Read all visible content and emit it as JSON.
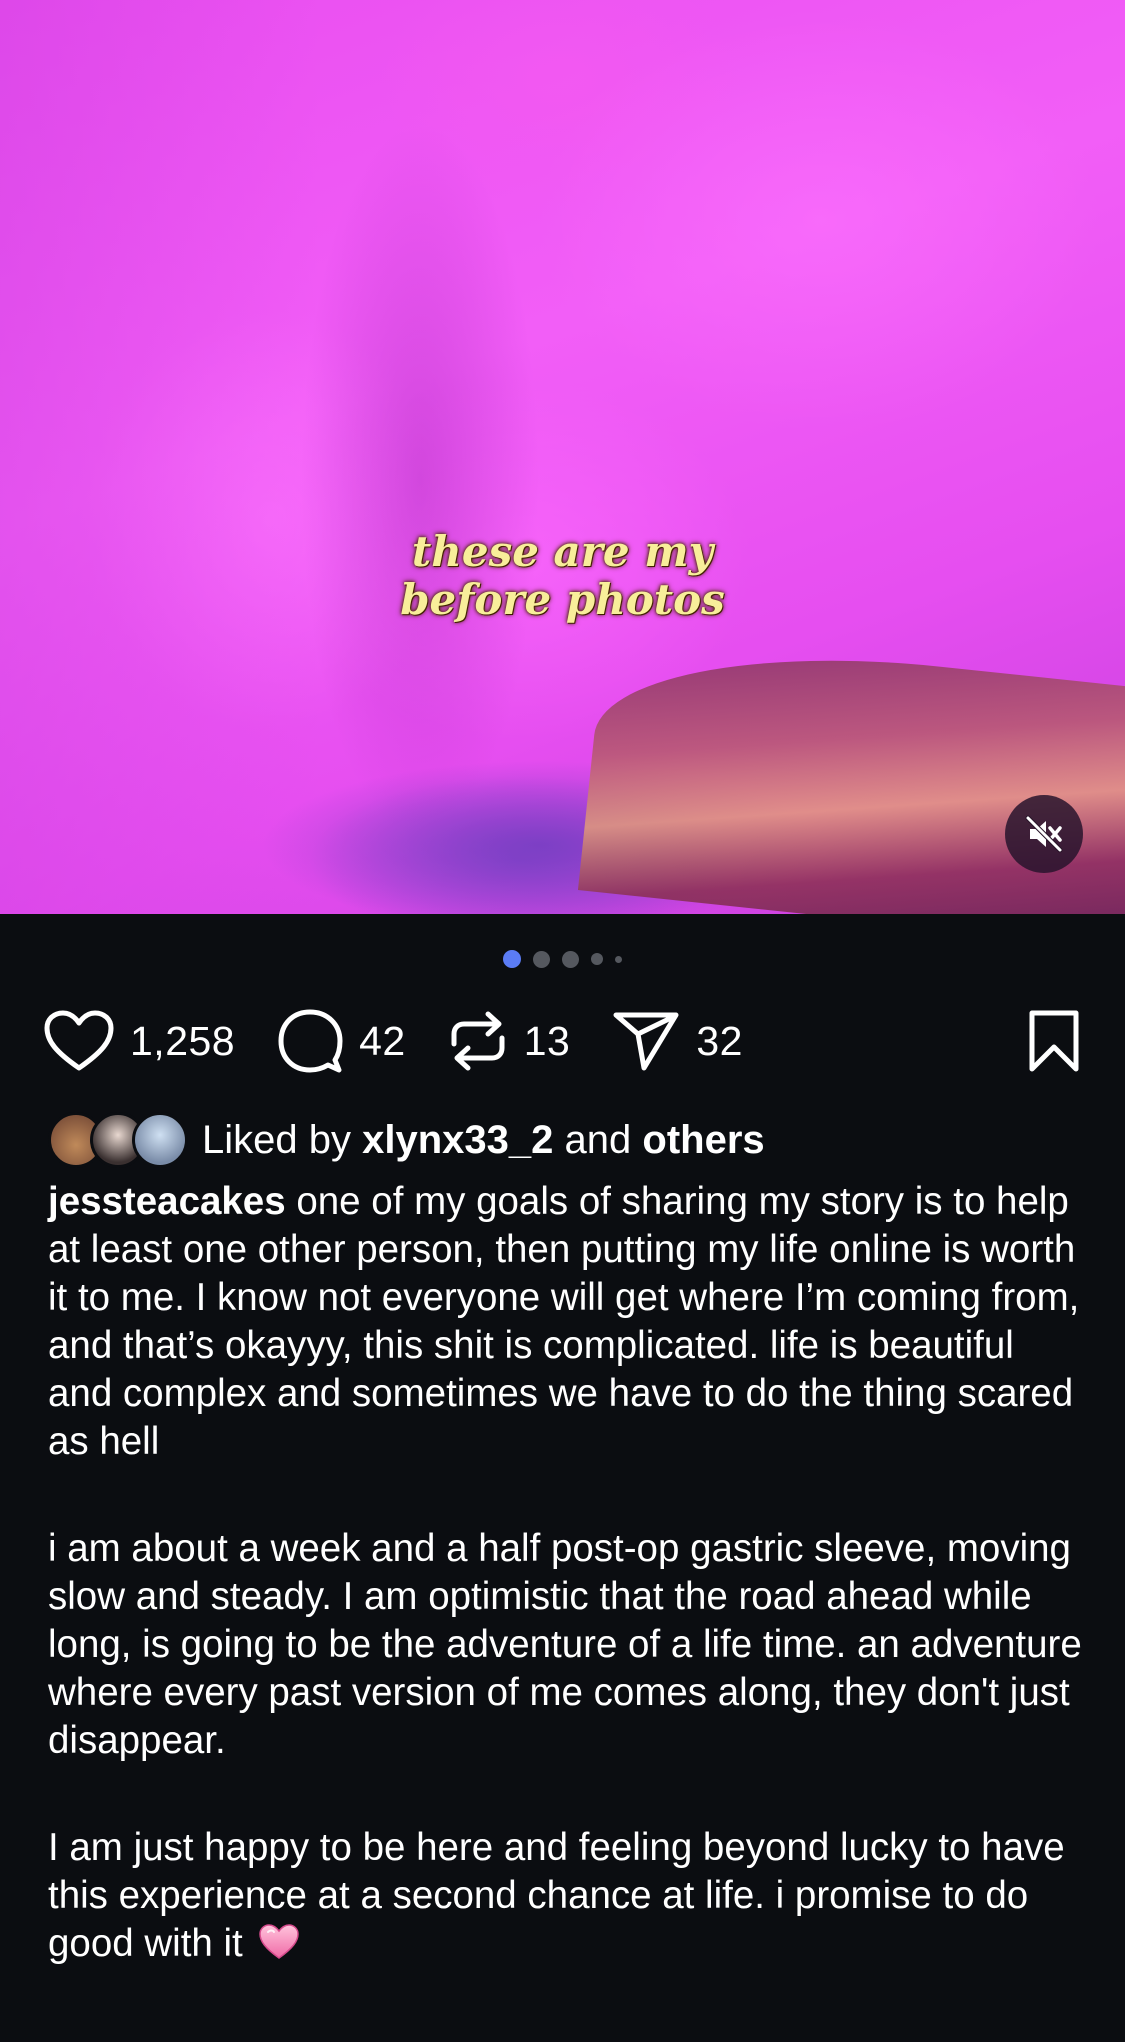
{
  "post": {
    "overlay_line1": "these are my",
    "overlay_line2": "before photos",
    "carousel_count": 5,
    "carousel_active": 0
  },
  "colors": {
    "accent": "#5b7cf5",
    "background": "#0b0d11",
    "overlay_text": "#f8ee9a"
  },
  "actions": {
    "likes": "1,258",
    "comments": "42",
    "reposts": "13",
    "shares": "32"
  },
  "liked_by": {
    "prefix": "Liked by",
    "user": "xlynx33_2",
    "middle": "and",
    "suffix": "others"
  },
  "caption": {
    "username": "jessteacakes",
    "paragraph1": "one of my goals of sharing my story is to help at least one other person, then putting my life online is worth it to me. I know not everyone will get where I’m coming from, and that’s okayyy, this shit is complicated. life is beautiful and complex and sometimes we have to do the thing scared as hell",
    "paragraph2": "i am about a week and a half post-op gastric sleeve, moving slow and steady. I am optimistic that the road ahead while long, is going to be the adventure of a life time. an adventure where every past version of me comes along, they don't just disappear.",
    "paragraph3": "I am just happy to be here and feeling beyond lucky to have this experience at a second chance at life. i promise to do good with it"
  },
  "icons": {
    "like": "heart-icon",
    "comment": "comment-bubble-icon",
    "repost": "repost-icon",
    "share": "send-icon",
    "save": "bookmark-icon",
    "mute": "speaker-muted-icon",
    "emoji": "pink-heart-emoji"
  }
}
